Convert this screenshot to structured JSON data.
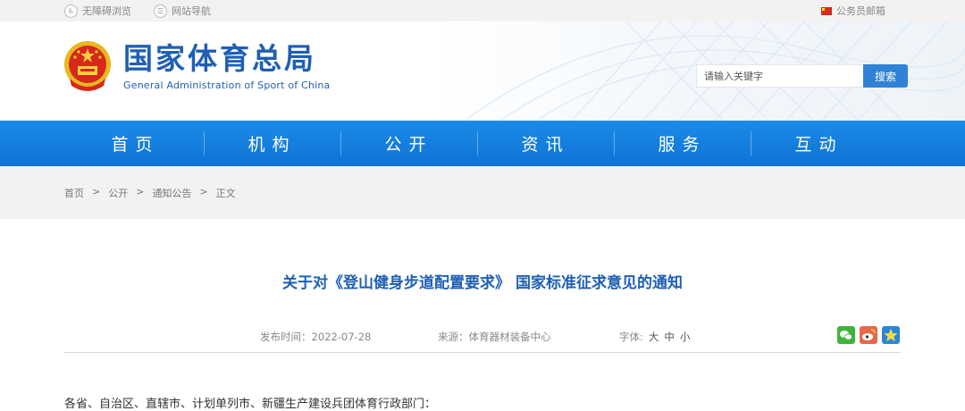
{
  "topbar": {
    "accessible_label": "无障碍浏览",
    "sitemap_label": "网站导航",
    "mail_label": "公务员邮箱"
  },
  "header": {
    "logo_cn": "国家体育总局",
    "logo_en": "General Administration of Sport of China",
    "search": {
      "placeholder": "请输入关键字",
      "button_label": "搜索"
    }
  },
  "nav": {
    "items": [
      "首页",
      "机构",
      "公开",
      "资讯",
      "服务",
      "互动"
    ]
  },
  "breadcrumb": {
    "items": [
      "首页",
      "公开",
      "通知公告",
      "正文"
    ],
    "separator": ">"
  },
  "article": {
    "title": "关于对《登山健身步道配置要求》 国家标准征求意见的通知",
    "publish_time": "发布时间：2022-07-28",
    "source": "来源：体育器材装备中心",
    "font_label": "字体:",
    "font_large": "大",
    "font_medium": "中",
    "font_small": "小",
    "first_line": "各省、自治区、直辖市、计划单列市、新疆生产建设兵团体育行政部门："
  },
  "colors": {
    "brand_blue": "#1f5fb4",
    "nav_blue": "#1b8be8",
    "search_button": "#2f83d6"
  },
  "icons": [
    "accessibility-icon",
    "sitemap-icon",
    "flag-icon",
    "national-emblem-icon",
    "wechat-share-icon",
    "weibo-share-icon",
    "favorite-share-icon"
  ]
}
